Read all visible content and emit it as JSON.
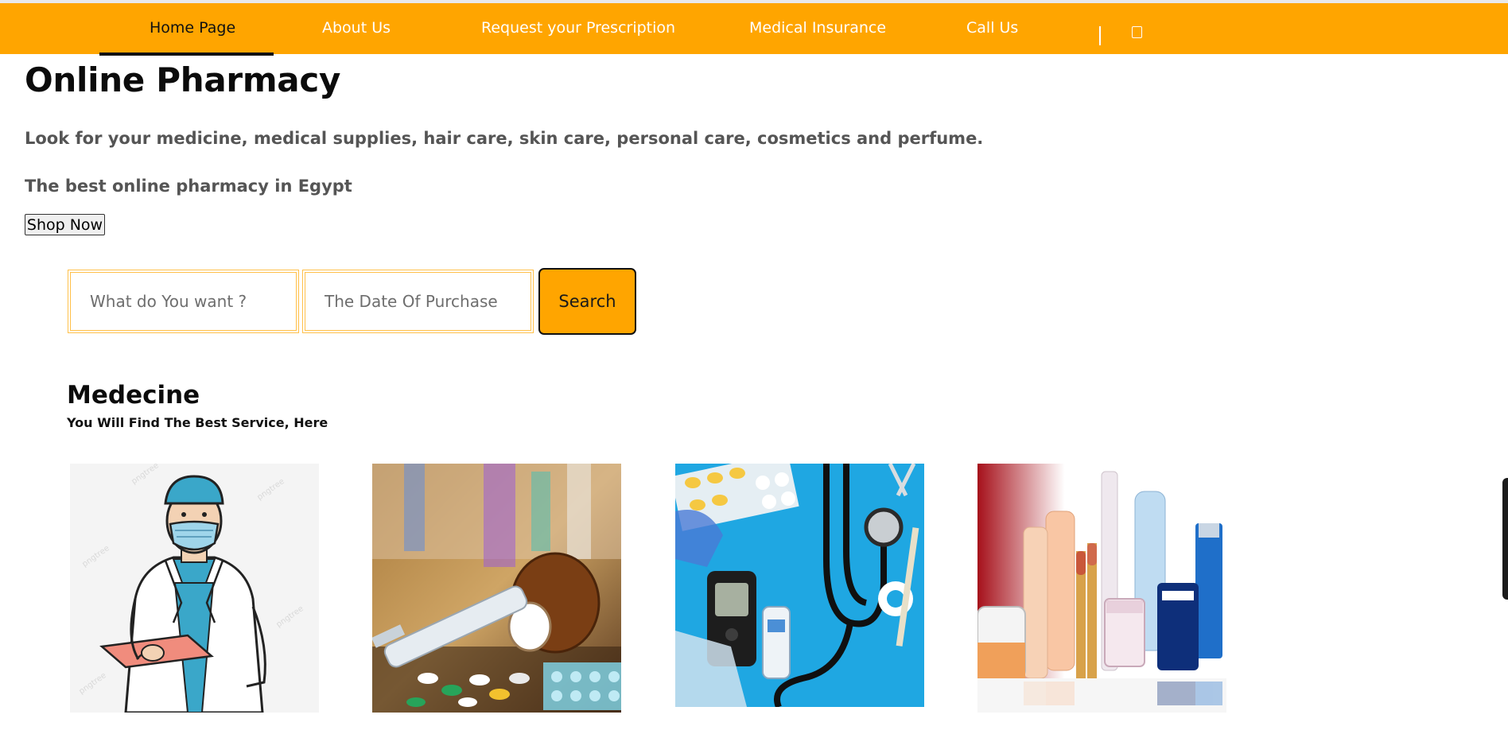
{
  "nav": {
    "items": [
      {
        "label": "Home Page",
        "active": true
      },
      {
        "label": "About Us",
        "active": false
      },
      {
        "label": "Request your Prescription",
        "active": false
      },
      {
        "label": "Medical Insurance",
        "active": false
      },
      {
        "label": "Call Us",
        "active": false
      }
    ],
    "icon": "cart-icon"
  },
  "hero": {
    "title": "Online Pharmacy",
    "lead": "Look for your medicine, medical supplies, hair care, skin care, personal care, cosmetics and perfume.",
    "tagline": "The best online pharmacy in Egypt",
    "shop_button": "Shop Now"
  },
  "search": {
    "query_placeholder": "What do You want ?",
    "date_placeholder": "The Date Of Purchase",
    "button_label": "Search"
  },
  "section": {
    "title": "Medecine",
    "subtitle": "You Will Find The Best Service, Here"
  },
  "cards": [
    {
      "image": "doctor-illustration"
    },
    {
      "image": "pills-and-syringe-photo"
    },
    {
      "image": "medical-supplies-photo"
    },
    {
      "image": "cosmetics-products-photo"
    }
  ],
  "colors": {
    "accent": "#ffa500",
    "nav_text": "#ffffff",
    "field_border": "#ffc04a",
    "muted_text": "#555555"
  }
}
